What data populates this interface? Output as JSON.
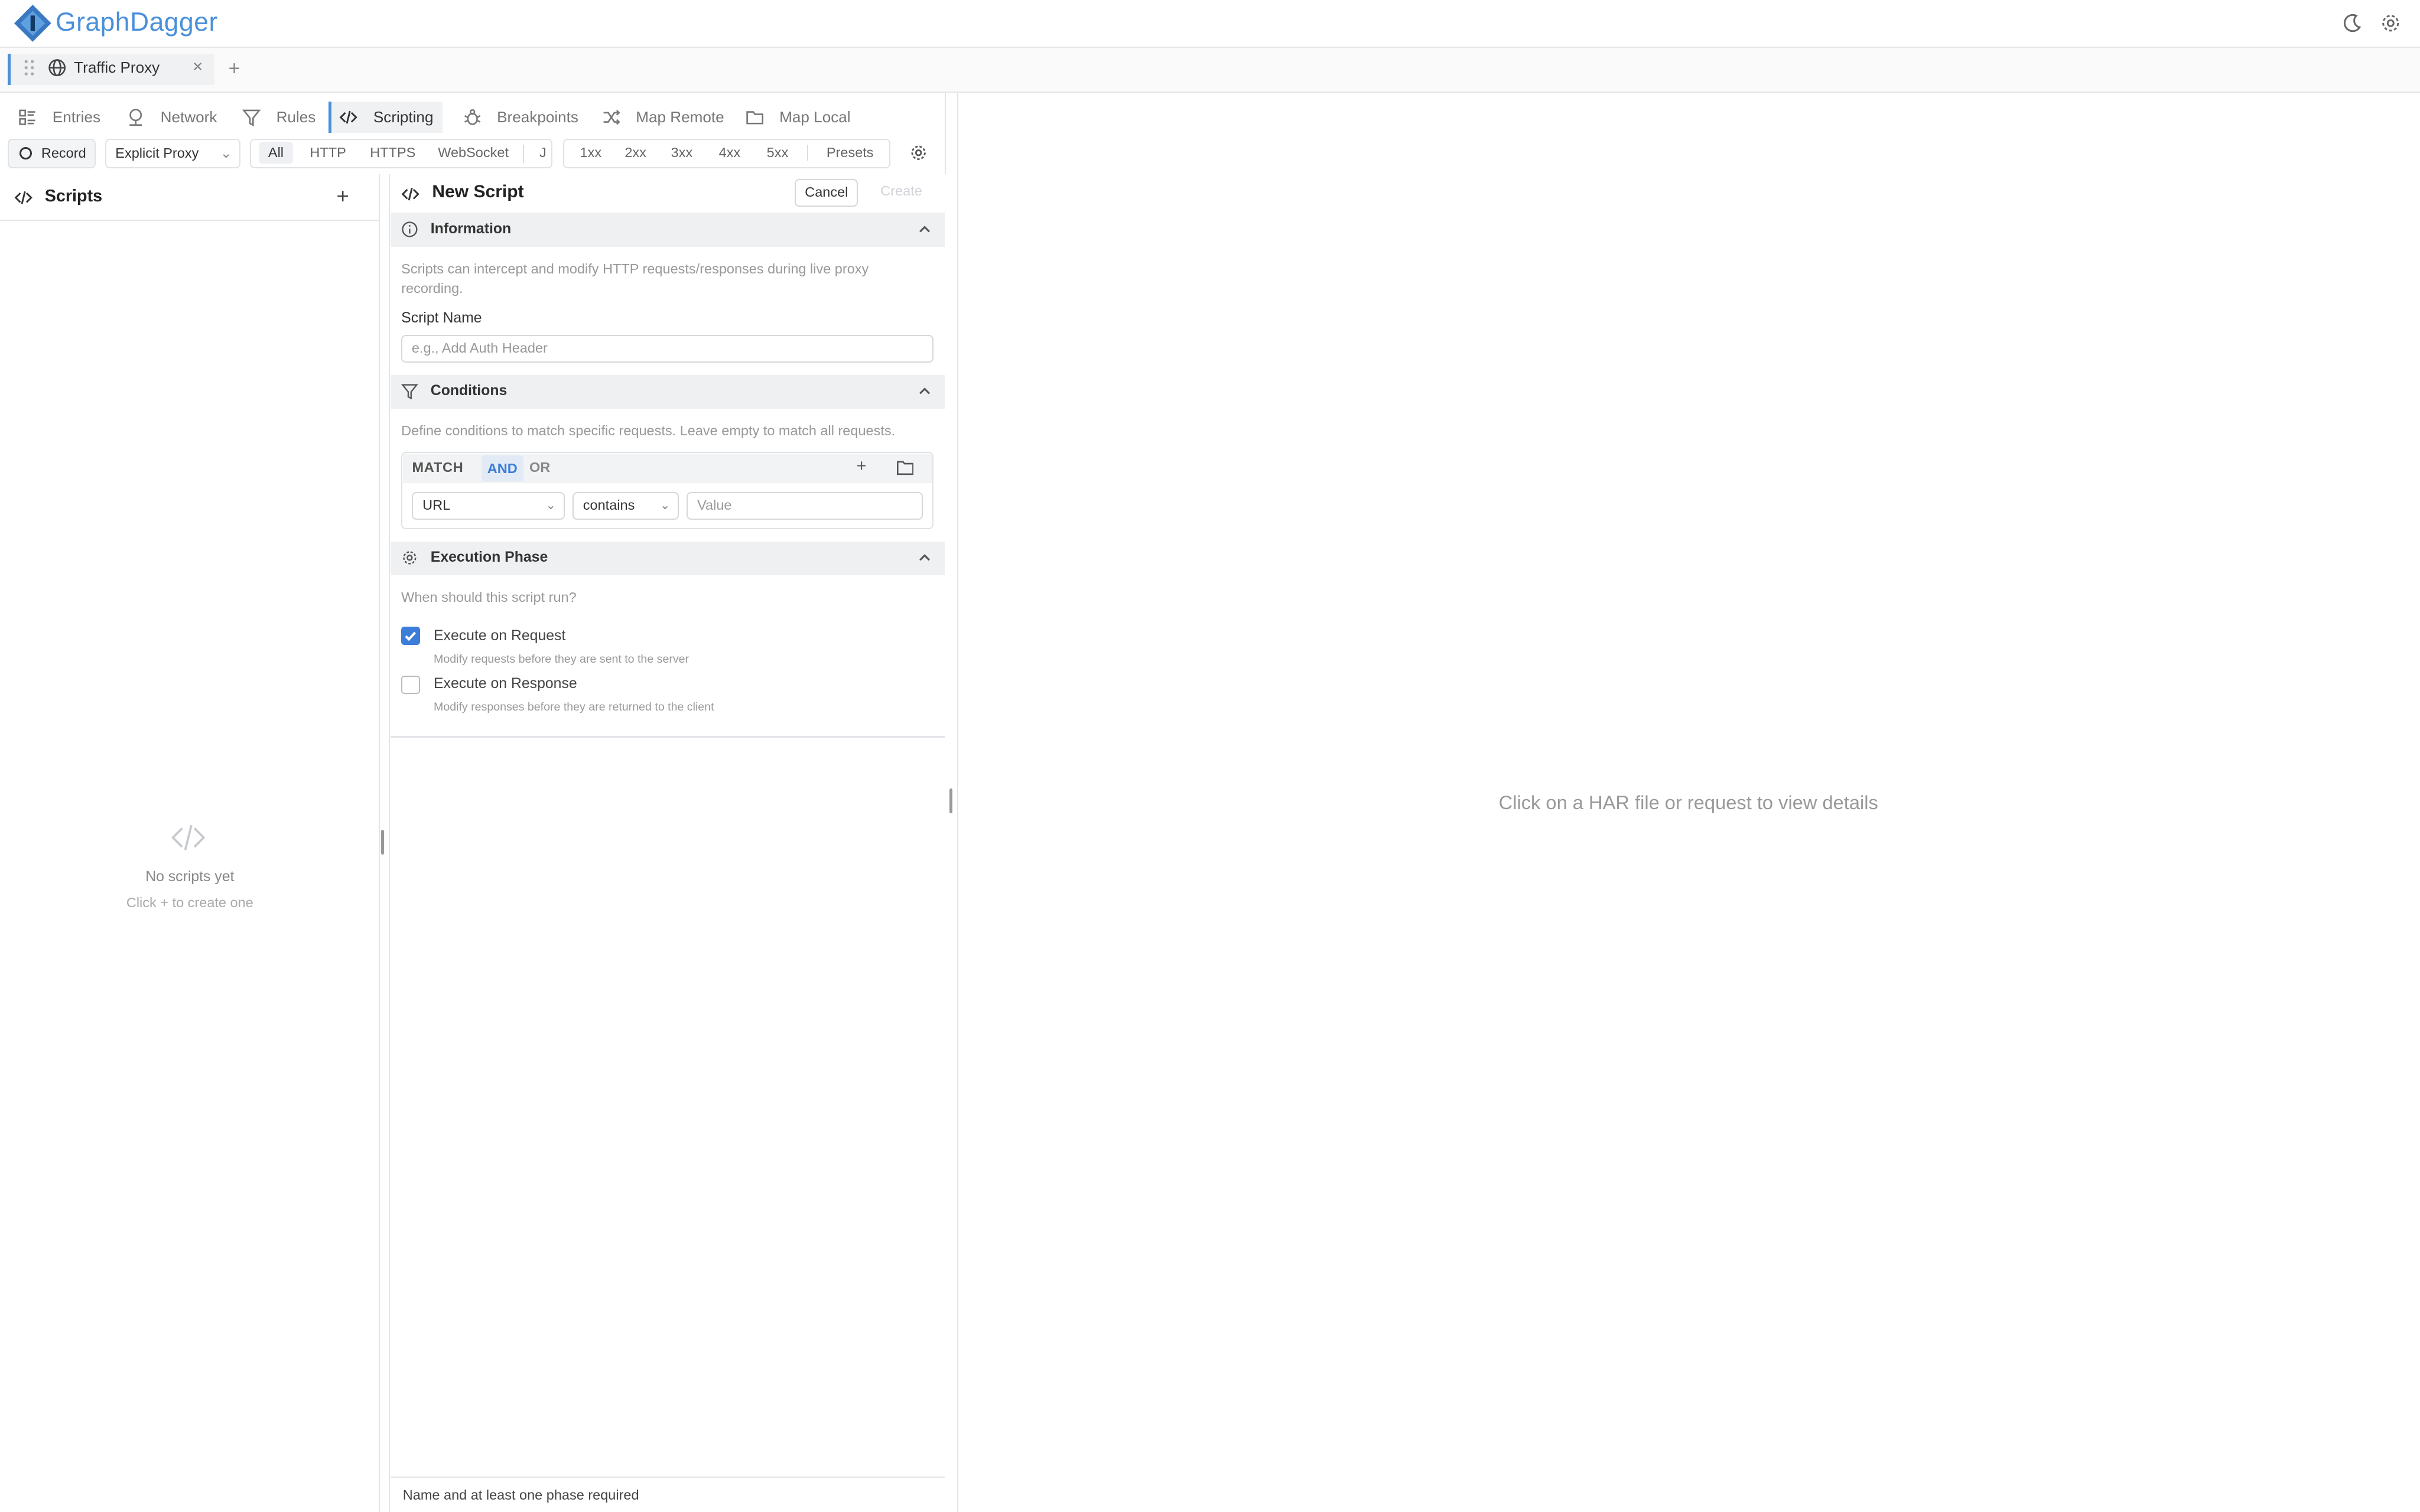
{
  "app": {
    "name": "GraphDagger"
  },
  "session_tabs": [
    {
      "label": "Traffic Proxy"
    }
  ],
  "nav": {
    "items": [
      {
        "label": "Entries"
      },
      {
        "label": "Network"
      },
      {
        "label": "Rules"
      },
      {
        "label": "Scripting",
        "active": true
      },
      {
        "label": "Breakpoints"
      },
      {
        "label": "Map Remote"
      },
      {
        "label": "Map Local"
      }
    ]
  },
  "toolbar": {
    "record_label": "Record",
    "proxy_mode": "Explicit Proxy",
    "protocol_filters": [
      "All",
      "HTTP",
      "HTTPS",
      "WebSocket",
      "J"
    ],
    "status_filters": [
      "1xx",
      "2xx",
      "3xx",
      "4xx",
      "5xx",
      "Presets"
    ]
  },
  "scripts_sidebar": {
    "title": "Scripts",
    "empty_title": "No scripts yet",
    "empty_hint": "Click + to create one"
  },
  "new_script": {
    "title": "New Script",
    "cancel_label": "Cancel",
    "create_label": "Create",
    "information": {
      "title": "Information",
      "description": "Scripts can intercept and modify HTTP requests/responses during live proxy recording.",
      "name_label": "Script Name",
      "name_placeholder": "e.g., Add Auth Header"
    },
    "conditions": {
      "title": "Conditions",
      "description": "Define conditions to match specific requests. Leave empty to match all requests.",
      "match_label": "MATCH",
      "and_label": "AND",
      "or_label": "OR",
      "field": "URL",
      "operator": "contains",
      "value_placeholder": "Value"
    },
    "execution": {
      "title": "Execution Phase",
      "question": "When should this script run?",
      "on_request_label": "Execute on Request",
      "on_request_desc": "Modify requests before they are sent to the server",
      "on_request_checked": true,
      "on_response_label": "Execute on Response",
      "on_response_desc": "Modify responses before they are returned to the client",
      "on_response_checked": false
    },
    "footer_message": "Name and at least one phase required"
  },
  "details_pane": {
    "empty_message": "Click on a HAR file or request to view details"
  },
  "colors": {
    "accent": "#3b7dd8",
    "brand": "#4a90d9"
  }
}
